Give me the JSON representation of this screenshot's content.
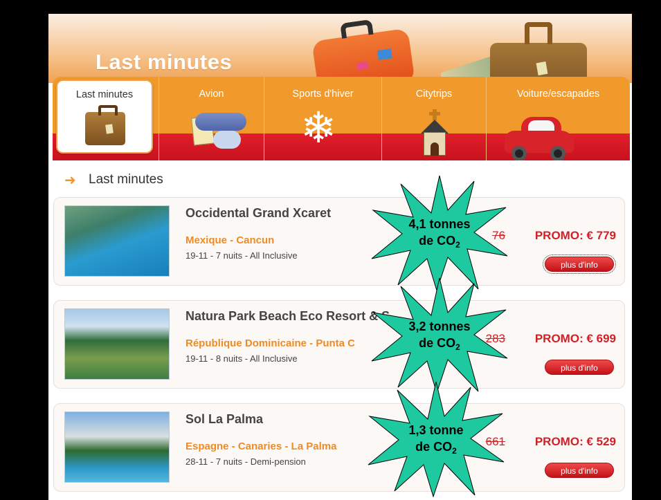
{
  "banner": {
    "title": "Last minutes"
  },
  "tabs": [
    {
      "label": "Last minutes",
      "icon": "suitcase-icon",
      "active": true
    },
    {
      "label": "Avion",
      "icon": "airplane-ticket-icon",
      "active": false
    },
    {
      "label": "Sports d'hiver",
      "icon": "snowflake-icon",
      "active": false
    },
    {
      "label": "Citytrips",
      "icon": "church-icon",
      "active": false
    },
    {
      "label": "Voiture/escapades",
      "icon": "car-icon",
      "active": false
    }
  ],
  "breadcrumb": {
    "arrow": "➜",
    "title": "Last minutes"
  },
  "listings": [
    {
      "name": "Occidental Grand Xcaret",
      "destination": "Mexique - Cancun",
      "details": "19-11 - 7 nuits - All Inclusive",
      "old_price": "76",
      "promo": "PROMO: € 779",
      "button": "plus d'info"
    },
    {
      "name": "Natura Park Beach Eco Resort & S",
      "destination": "République Dominicaine - Punta C",
      "details": "19-11 - 8 nuits - All Inclusive",
      "old_price": "283",
      "promo": "PROMO: € 699",
      "button": "plus d'info"
    },
    {
      "name": "Sol La Palma",
      "destination": "Espagne - Canaries - La Palma",
      "details": "28-11 - 7 nuits - Demi-pension",
      "old_price": "661",
      "promo": "PROMO: € 529",
      "button": "plus d'info"
    }
  ],
  "co2_badges": [
    {
      "line1": "4,1 tonnes",
      "line2_prefix": "de CO",
      "line2_sub": "2"
    },
    {
      "line1": "3,2 tonnes",
      "line2_prefix": "de CO",
      "line2_sub": "2"
    },
    {
      "line1": "1,3 tonne",
      "line2_prefix": "de CO",
      "line2_sub": "2"
    }
  ],
  "colors": {
    "accent_orange": "#f19a2b",
    "accent_red": "#d21f26",
    "burst_green": "#1ec9a0"
  }
}
